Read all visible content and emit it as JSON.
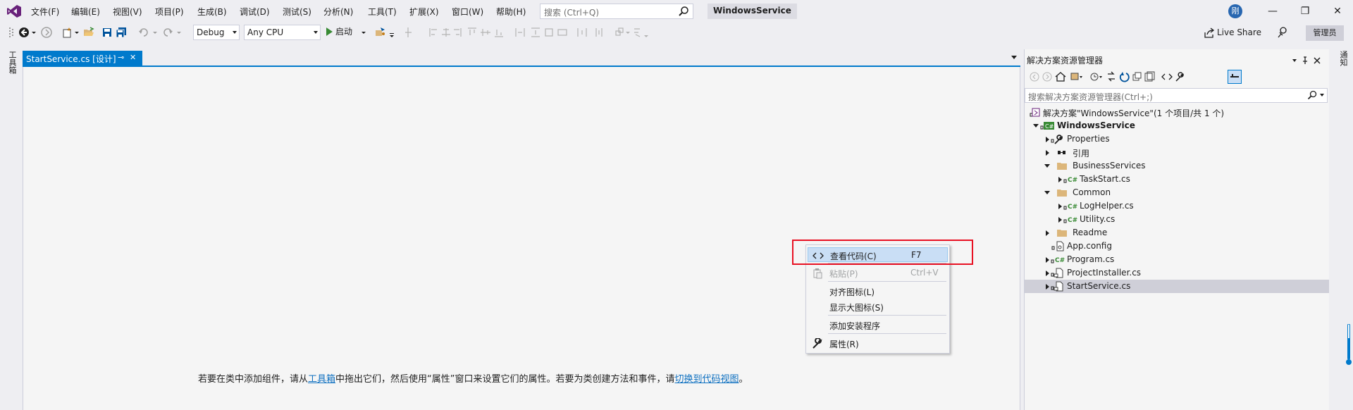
{
  "menubar": {
    "items": [
      "文件(F)",
      "编辑(E)",
      "视图(V)",
      "项目(P)",
      "生成(B)",
      "调试(D)",
      "测试(S)",
      "分析(N)",
      "工具(T)",
      "扩展(X)",
      "窗口(W)",
      "帮助(H)"
    ],
    "search_placeholder": "搜索 (Ctrl+Q)",
    "solution_name": "WindowsService",
    "avatar_initial": "刚",
    "minimize": "—",
    "maximize": "❐",
    "close": "✕"
  },
  "toolbar": {
    "config": "Debug",
    "platform": "Any CPU",
    "start_label": "启动",
    "live_share": "Live Share",
    "admin_label": "管理员"
  },
  "left_strip": {
    "label": "工具箱"
  },
  "right_strip": {
    "label": "通知"
  },
  "document": {
    "tab_title": "StartService.cs [设计]",
    "pin_glyph": "⊸",
    "close_glyph": "✕",
    "hint_prefix": "若要在类中添加组件，请从",
    "hint_link1": "工具箱",
    "hint_middle": "中拖出它们，然后使用“属性”窗口来设置它们的属性。若要为类创建方法和事件，请",
    "hint_link2": "切换到代码视图",
    "hint_suffix": "。"
  },
  "context_menu": {
    "items": [
      {
        "label": "查看代码(C)",
        "shortcut": "F7",
        "icon": "code-icon",
        "enabled": true,
        "highlighted": true
      },
      {
        "label": "粘贴(P)",
        "shortcut": "Ctrl+V",
        "icon": "paste-icon",
        "enabled": false,
        "highlighted": false
      },
      {
        "label": "对齐图标(L)",
        "shortcut": "",
        "icon": "",
        "enabled": true,
        "highlighted": false
      },
      {
        "label": "显示大图标(S)",
        "shortcut": "",
        "icon": "",
        "enabled": true,
        "highlighted": false
      },
      {
        "label": "添加安装程序",
        "shortcut": "",
        "icon": "",
        "enabled": true,
        "highlighted": false
      },
      {
        "label": "属性(R)",
        "shortcut": "",
        "icon": "wrench-icon",
        "enabled": true,
        "highlighted": false
      }
    ]
  },
  "solution_explorer": {
    "title": "解决方案资源管理器",
    "search_placeholder": "搜索解决方案资源管理器(Ctrl+;)",
    "tree": [
      {
        "label": "解决方案\"WindowsService\"(1 个项目/共 1 个)",
        "icon": "solution-icon",
        "expander": "none",
        "bold": false,
        "selected": false
      },
      {
        "label": "WindowsService",
        "icon": "csharp-project-icon",
        "expander": "expanded",
        "bold": true,
        "selected": false
      },
      {
        "label": "Properties",
        "icon": "wrench-icon",
        "expander": "collapsed",
        "bold": false,
        "selected": false
      },
      {
        "label": "引用",
        "icon": "references-icon",
        "expander": "collapsed",
        "bold": false,
        "selected": false
      },
      {
        "label": "BusinessServices",
        "icon": "folder-icon",
        "expander": "expanded",
        "bold": false,
        "selected": false
      },
      {
        "label": "TaskStart.cs",
        "icon": "csharp-file-icon",
        "expander": "collapsed",
        "bold": false,
        "selected": false
      },
      {
        "label": "Common",
        "icon": "folder-icon",
        "expander": "expanded",
        "bold": false,
        "selected": false
      },
      {
        "label": "LogHelper.cs",
        "icon": "csharp-file-icon",
        "expander": "collapsed",
        "bold": false,
        "selected": false
      },
      {
        "label": "Utility.cs",
        "icon": "csharp-file-icon",
        "expander": "collapsed",
        "bold": false,
        "selected": false
      },
      {
        "label": "Readme",
        "icon": "folder-icon",
        "expander": "collapsed",
        "bold": false,
        "selected": false
      },
      {
        "label": "App.config",
        "icon": "config-file-icon",
        "expander": "none",
        "bold": false,
        "selected": false
      },
      {
        "label": "Program.cs",
        "icon": "csharp-file-icon",
        "expander": "collapsed",
        "bold": false,
        "selected": false
      },
      {
        "label": "ProjectInstaller.cs",
        "icon": "component-file-icon",
        "expander": "collapsed",
        "bold": false,
        "selected": false
      },
      {
        "label": "StartService.cs",
        "icon": "component-file-icon",
        "expander": "collapsed",
        "bold": false,
        "selected": true
      }
    ]
  },
  "colors": {
    "accent": "#007acc",
    "highlight_box": "#e81123",
    "link": "#0e70c0",
    "selection": "#cfcfd8",
    "menu_hover": "#c9def5"
  }
}
